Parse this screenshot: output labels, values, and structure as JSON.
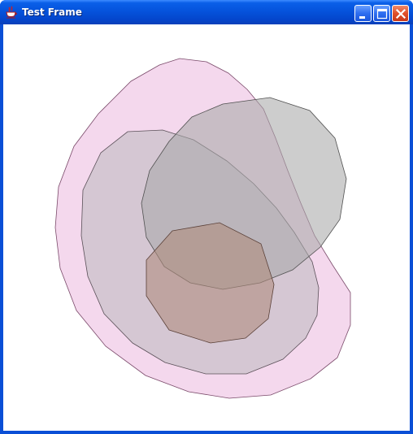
{
  "window": {
    "title": "Test Frame",
    "app_icon": "java-cup-icon",
    "controls": {
      "minimize_icon": "minimize-icon",
      "maximize_icon": "maximize-icon",
      "close_icon": "close-icon"
    }
  },
  "canvas": {
    "background": "#ffffff",
    "shapes": [
      {
        "name": "pink-blob",
        "fill": "#f0c8e6",
        "stroke": "#7a4a6a"
      },
      {
        "name": "gray-mid-blob",
        "fill": "#c8c0c8",
        "stroke": "#5a5058"
      },
      {
        "name": "gray-right-blob",
        "fill": "#a8a8a8",
        "stroke": "#505050"
      },
      {
        "name": "brown-blob",
        "fill": "#b08c7c",
        "stroke": "#5a4038"
      }
    ]
  }
}
